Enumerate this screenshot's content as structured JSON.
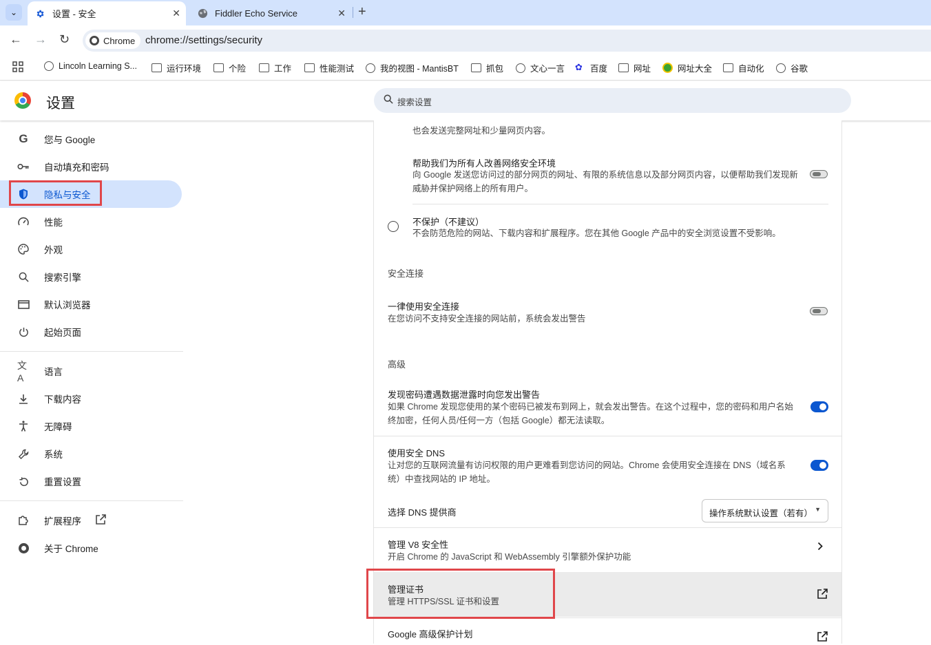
{
  "tabs": [
    {
      "title": "设置 - 安全",
      "active": true
    },
    {
      "title": "Fiddler Echo Service",
      "active": false
    }
  ],
  "toolbar": {
    "chip_label": "Chrome",
    "url": "chrome://settings/security"
  },
  "bookmarks": [
    {
      "label": "Lincoln Learning S...",
      "icon": "globe"
    },
    {
      "label": "运行环境",
      "icon": "folder"
    },
    {
      "label": "个险",
      "icon": "folder"
    },
    {
      "label": "工作",
      "icon": "folder"
    },
    {
      "label": "性能测试",
      "icon": "folder"
    },
    {
      "label": "我的视图 - MantisBT",
      "icon": "globe"
    },
    {
      "label": "抓包",
      "icon": "folder"
    },
    {
      "label": "文心一言",
      "icon": "globe"
    },
    {
      "label": "百度",
      "icon": "paw"
    },
    {
      "label": "网址",
      "icon": "folder"
    },
    {
      "label": "网址大全",
      "icon": "hao123"
    },
    {
      "label": "自动化",
      "icon": "folder"
    },
    {
      "label": "谷歌",
      "icon": "globe"
    }
  ],
  "header": {
    "title": "设置",
    "search_placeholder": "搜索设置"
  },
  "sidebar": {
    "items": [
      {
        "label": "您与 Google",
        "icon": "google-g-icon"
      },
      {
        "label": "自动填充和密码",
        "icon": "key-icon"
      },
      {
        "label": "隐私与安全",
        "icon": "shield-icon",
        "selected": true
      },
      {
        "label": "性能",
        "icon": "speedometer-icon"
      },
      {
        "label": "外观",
        "icon": "palette-icon"
      },
      {
        "label": "搜索引擎",
        "icon": "search-icon"
      },
      {
        "label": "默认浏览器",
        "icon": "browser-icon"
      },
      {
        "label": "起始页面",
        "icon": "power-icon"
      },
      {
        "label": "语言",
        "icon": "translate-icon"
      },
      {
        "label": "下载内容",
        "icon": "download-icon"
      },
      {
        "label": "无障碍",
        "icon": "accessibility-icon"
      },
      {
        "label": "系统",
        "icon": "wrench-icon"
      },
      {
        "label": "重置设置",
        "icon": "reset-icon"
      },
      {
        "label": "扩展程序",
        "icon": "extension-icon"
      },
      {
        "label": "关于 Chrome",
        "icon": "chrome-icon"
      }
    ]
  },
  "main": {
    "partial_top_line": "也会发送完整网址和少量网页内容。",
    "improve": {
      "title": "帮助我们为所有人改善网络安全环境",
      "desc": "向 Google 发送您访问过的部分网页的网址、有限的系统信息以及部分网页内容，以便帮助我们发现新威胁并保护网络上的所有用户。",
      "enabled": false
    },
    "no_protection": {
      "title": "不保护（不建议）",
      "desc": "不会防范危险的网站、下载内容和扩展程序。您在其他 Google 产品中的安全浏览设置不受影响。"
    },
    "secure_conn_header": "安全连接",
    "always_secure": {
      "title": "一律使用安全连接",
      "desc": "在您访问不支持安全连接的网站前，系统会发出警告",
      "enabled": false
    },
    "advanced_header": "高级",
    "pw_leak": {
      "title": "发现密码遭遇数据泄露时向您发出警告",
      "desc": "如果 Chrome 发现您使用的某个密码已被发布到网上，就会发出警告。在这个过程中，您的密码和用户名始终加密，任何人员/任何一方（包括 Google）都无法读取。",
      "enabled": true
    },
    "secure_dns": {
      "title": "使用安全 DNS",
      "desc": "让对您的互联网流量有访问权限的用户更难看到您访问的网站。Chrome 会使用安全连接在 DNS（域名系统）中查找网站的 IP 地址。",
      "enabled": true
    },
    "dns_provider": {
      "label": "选择 DNS 提供商",
      "value": "操作系统默认设置（若有）"
    },
    "v8": {
      "title": "管理 V8 安全性",
      "desc": "开启 Chrome 的 JavaScript 和 WebAssembly 引擎额外保护功能"
    },
    "certs": {
      "title": "管理证书",
      "desc": "管理 HTTPS/SSL 证书和设置"
    },
    "gapp": {
      "title": "Google 高级保护计划"
    }
  },
  "colors": {
    "accent": "#0b57d0",
    "highlight_box": "#e0464a",
    "selected_bg": "#d3e3fd"
  }
}
